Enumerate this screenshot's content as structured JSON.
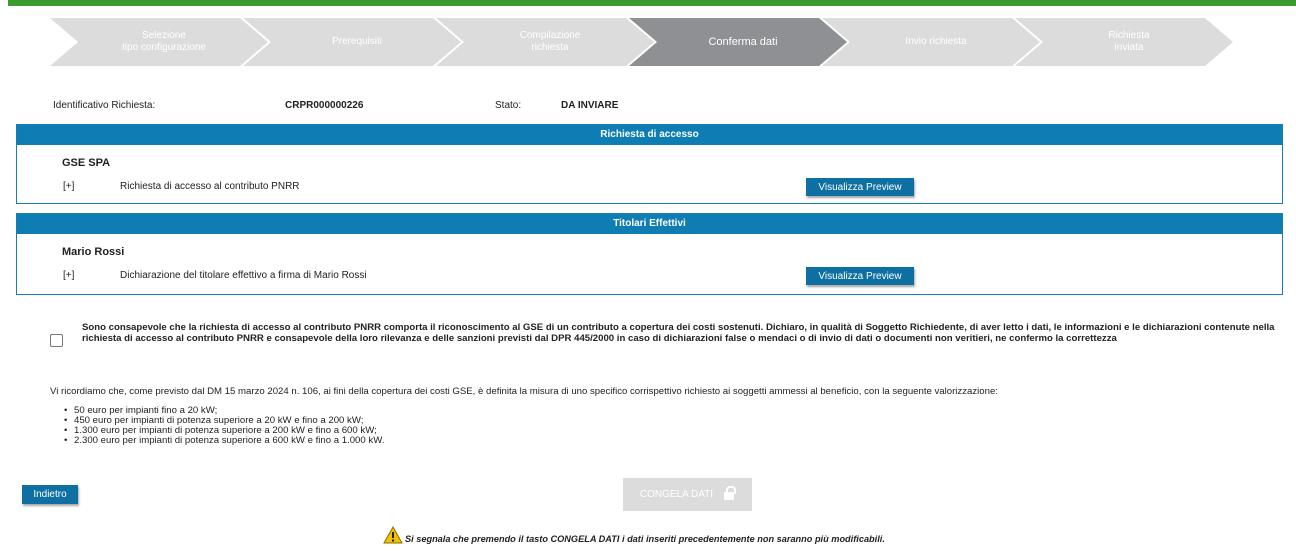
{
  "wizard": {
    "steps": [
      {
        "line1": "Selezione",
        "line2": "tipo configurazione"
      },
      {
        "line1": "Prerequisiti",
        "line2": ""
      },
      {
        "line1": "Compilazione",
        "line2": "richiesta"
      },
      {
        "line1": "Conferma dati",
        "line2": ""
      },
      {
        "line1": "Invio richiesta",
        "line2": ""
      },
      {
        "line1": "Richiesta",
        "line2": "inviata"
      }
    ],
    "active_index": 3
  },
  "request": {
    "id_label": "Identificativo Richiesta:",
    "id_value": "CRPR000000226",
    "status_label": "Stato:",
    "status_value": "DA INVIARE"
  },
  "access_panel": {
    "title": "Richiesta di accesso",
    "holder": "GSE SPA",
    "expand": "[+]",
    "description": "Richiesta di accesso al contributo PNRR",
    "button": "Visualizza Preview"
  },
  "owners_panel": {
    "title": "Titolari Effettivi",
    "holder": "Mario Rossi",
    "expand": "[+]",
    "description": "Dichiarazione del titolare effettivo a firma di Mario Rossi",
    "button": "Visualizza Preview"
  },
  "consent": {
    "checked": false,
    "text": "Sono consapevole che la richiesta di accesso al contributo PNRR comporta il riconoscimento al GSE di un contributo a copertura dei costi sostenuti. Dichiaro, in qualità di Soggetto Richiedente, di aver letto i dati, le informazioni e le dichiarazioni contenute nella richiesta di accesso al contributo PNRR e consapevole della loro rilevanza e delle sanzioni previsti dal DPR 445/2000 in caso di dichiarazioni false o mendaci o di invio di dati o documenti non veritieri, ne confermo la correttezza"
  },
  "note": "Vi ricordiamo che, come previsto dal DM 15 marzo 2024 n. 106, ai fini della copertura dei costi GSE, è definita la misura di uno specifico corrispettivo richiesto ai soggetti ammessi al beneficio, con la seguente valorizzazione:",
  "fees": [
    "50 euro per impianti fino a 20 kW;",
    "450 euro per impianti di potenza superiore a 20 kW e fino a 200 kW;",
    "1.300 euro per impianti di potenza superiore a 200 kW e fino a 600 kW;",
    "2.300 euro per impianti di potenza superiore a 600 kW e fino a 1.000 kW."
  ],
  "buttons": {
    "back": "Indietro",
    "freeze": "CONGELA DATI"
  },
  "warning": "Si segnala che premendo il tasto CONGELA DATI i dati inseriti precedentemente non saranno più modificabili.",
  "colors": {
    "accent_green": "#3a9a2e",
    "panel_blue": "#0e7db4",
    "button_blue": "#0e6fa3",
    "step_inactive": "#dcdcdc",
    "step_active": "#8e9093"
  }
}
